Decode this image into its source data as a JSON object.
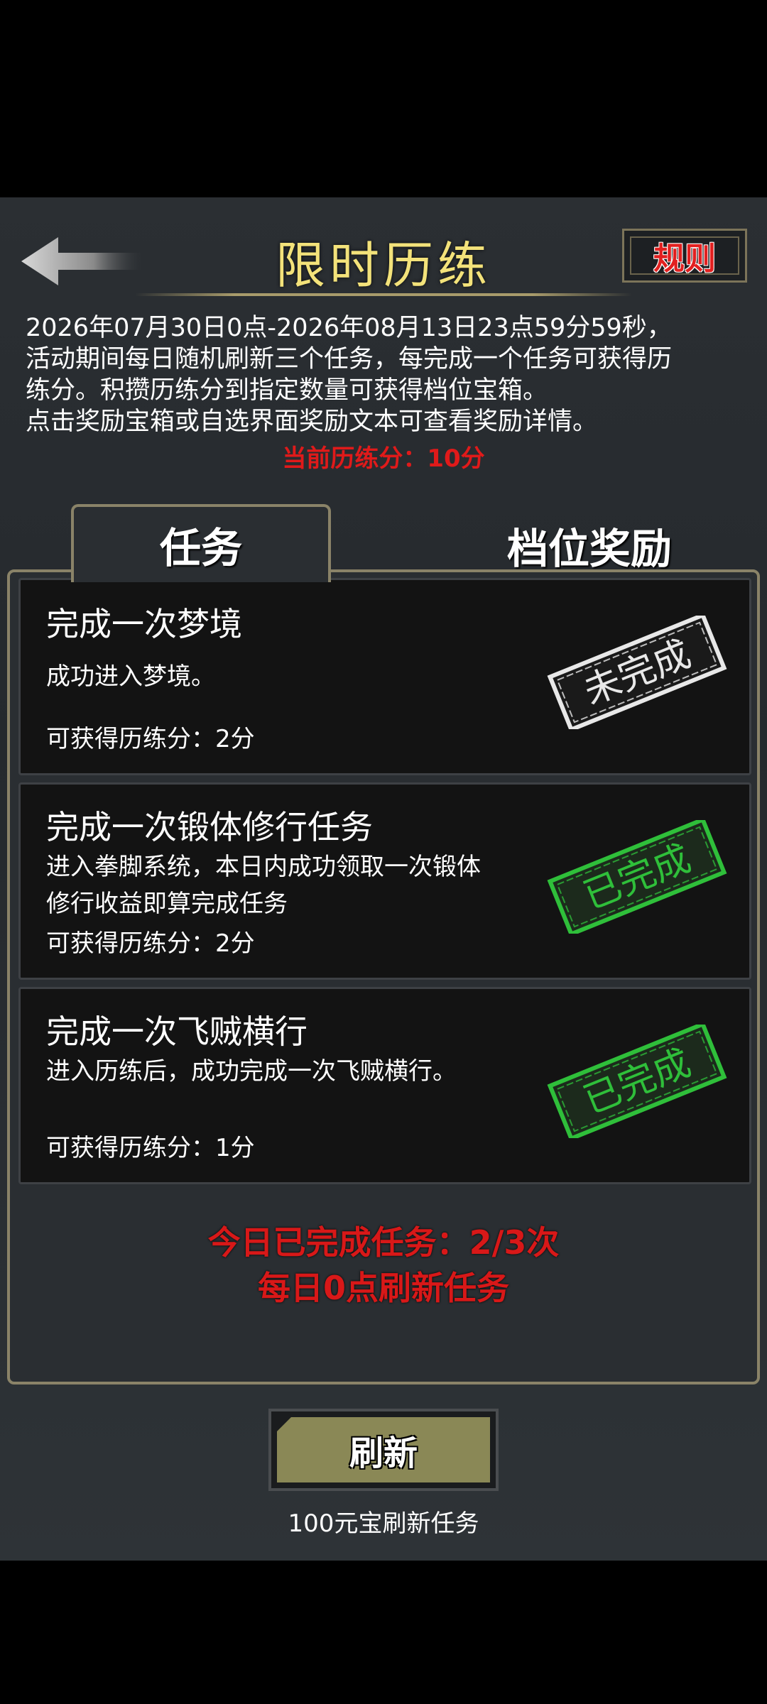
{
  "header": {
    "title": "限时历练",
    "rules_label": "规则"
  },
  "description": {
    "lines": [
      "2026年07月30日0点-2026年08月13日23点59分59秒，",
      "活动期间每日随机刷新三个任务，每完成一个任务可获得历",
      "练分。积攒历练分到指定数量可获得档位宝箱。",
      "点击奖励宝箱或自选界面奖励文本可查看奖励详情。"
    ],
    "current_points": "当前历练分：10分"
  },
  "tabs": {
    "active": "任务",
    "inactive": "档位奖励"
  },
  "tasks": [
    {
      "title": "完成一次梦境",
      "desc": "成功进入梦境。",
      "points": "可获得历练分：2分",
      "status": "未完成"
    },
    {
      "title": "完成一次锻体修行任务",
      "desc": "进入拳脚系统，本日内成功领取一次锻体修行收益即算完成任务",
      "points": "可获得历练分：2分",
      "status": "已完成"
    },
    {
      "title": "完成一次飞贼横行",
      "desc": "进入历练后，成功完成一次飞贼横行。",
      "points": "可获得历练分：1分",
      "status": "已完成"
    }
  ],
  "footer": {
    "completed": "今日已完成任务：2/3次",
    "refresh_note": "每日0点刷新任务",
    "refresh_label": "刷新",
    "refresh_cost": "100元宝刷新任务"
  },
  "colors": {
    "title_gold": "#f3e27a",
    "alert_red": "#e01a1a",
    "stamp_green": "#2fbf3a",
    "stamp_white": "#e8e8e8",
    "button_olive": "#8a8856"
  }
}
